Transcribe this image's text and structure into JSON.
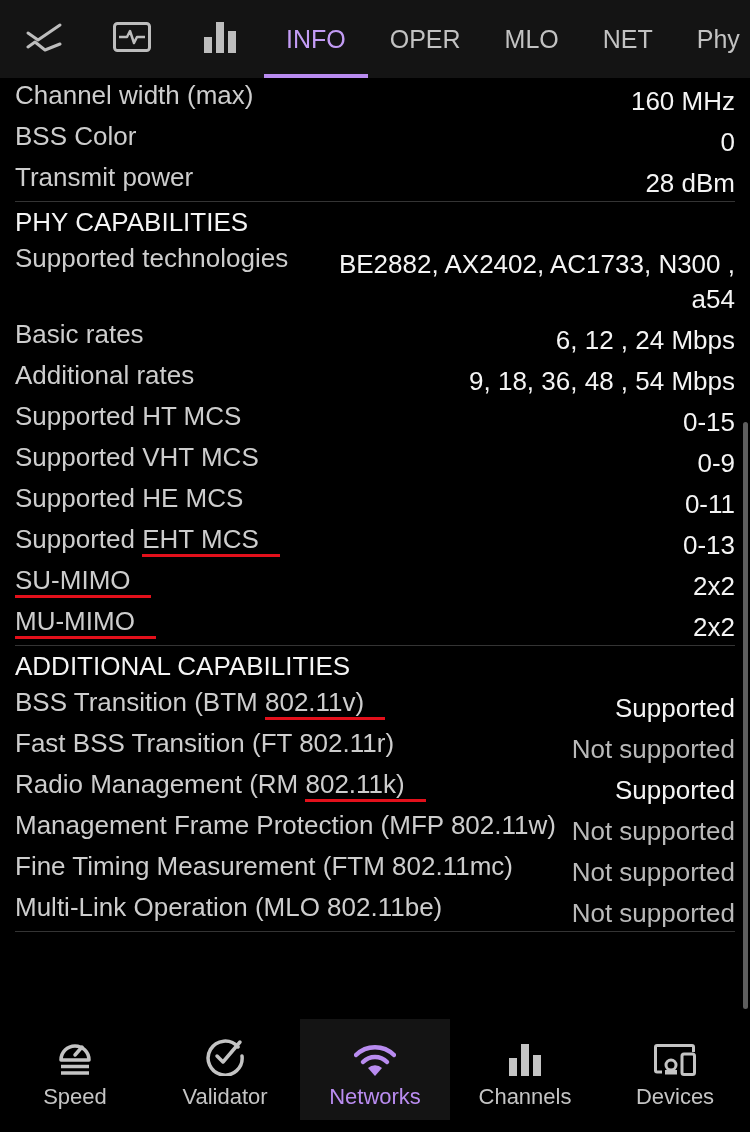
{
  "icon_tabs": [
    {
      "selected": false
    },
    {
      "selected": false
    },
    {
      "selected": false
    }
  ],
  "tabs": [
    {
      "label": "INFO",
      "selected": true
    },
    {
      "label": "OPER",
      "selected": false
    },
    {
      "label": "MLO",
      "selected": false
    },
    {
      "label": "NET",
      "selected": false
    },
    {
      "label": "Phy",
      "selected": false
    }
  ],
  "sections": [
    {
      "rows": [
        {
          "label": "Channel width (max)",
          "value": "160 MHz"
        },
        {
          "label": "BSS Color",
          "value": "0"
        },
        {
          "label": "Transmit power",
          "value": "28 dBm"
        }
      ]
    },
    {
      "title": "PHY CAPABILITIES",
      "rows": [
        {
          "label": "Supported technologies",
          "value": "BE2882, AX2402, AC1733, N300 , a54"
        },
        {
          "label": "Basic rates",
          "value": "6, 12 , 24 Mbps"
        },
        {
          "label": "Additional rates",
          "value": "9, 18, 36, 48 , 54 Mbps"
        },
        {
          "label": "Supported HT MCS",
          "value": "0-15"
        },
        {
          "label": "Supported VHT MCS",
          "value": "0-9"
        },
        {
          "label": "Supported HE MCS",
          "value": "0-11"
        },
        {
          "label_parts": [
            {
              "text": "Supported ",
              "underlined": false
            },
            {
              "text": "EHT MCS",
              "underlined": true
            }
          ],
          "value": "0-13"
        },
        {
          "label_parts": [
            {
              "text": "SU-MIMO",
              "underlined": true
            }
          ],
          "value": "2x2"
        },
        {
          "label_parts": [
            {
              "text": "MU-MIMO",
              "underlined": true
            }
          ],
          "value": "2x2"
        }
      ]
    },
    {
      "title": "ADDITIONAL CAPABILITIES",
      "rows": [
        {
          "label_parts": [
            {
              "text": "BSS Transition (BTM ",
              "underlined": false
            },
            {
              "text": "802.11v)",
              "underlined": true
            }
          ],
          "value": "Supported",
          "supported": true
        },
        {
          "label": "Fast BSS Transition (FT 802.11r)",
          "value": "Not supported",
          "supported": false
        },
        {
          "label_parts": [
            {
              "text": "Radio Management (RM ",
              "underlined": false
            },
            {
              "text": "802.11k)",
              "underlined": true
            }
          ],
          "value": "Supported",
          "supported": true
        },
        {
          "label": "Management Frame Protection (MFP 802.11w)",
          "value": "Not supported",
          "supported": false
        },
        {
          "label": "Fine Timing Measurement (FTM 802.11mc)",
          "value": "Not supported",
          "supported": false
        },
        {
          "label": "Multi-Link Operation (MLO 802.11be)",
          "value": "Not supported",
          "supported": false
        }
      ]
    }
  ],
  "bottom_nav": [
    {
      "label": "Speed",
      "selected": false
    },
    {
      "label": "Validator",
      "selected": false
    },
    {
      "label": "Networks",
      "selected": true
    },
    {
      "label": "Channels",
      "selected": false
    },
    {
      "label": "Devices",
      "selected": false
    }
  ]
}
